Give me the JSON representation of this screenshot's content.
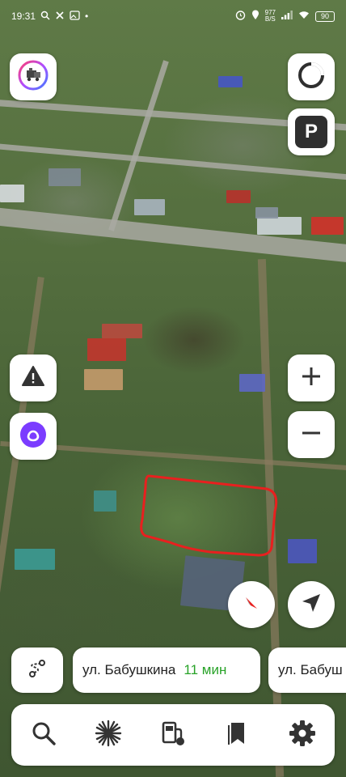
{
  "status_bar": {
    "time": "19:31",
    "net_speed": "977",
    "net_unit": "B/S",
    "battery": "90"
  },
  "route_chips": [
    {
      "street": "ул. Бабушкина",
      "eta": "11 мин"
    },
    {
      "street": "ул. Бабуш",
      "eta": ""
    }
  ],
  "colors": {
    "accent_green": "#29a329",
    "highlight_outline": "#e8201f",
    "alice_purple": "#7b3cff"
  },
  "icons": {
    "top_left": "layers-icon",
    "top_right": "circle-icon",
    "parking": "parking-icon",
    "warning": "warning-icon",
    "assistant": "alice-icon",
    "zoom_in": "plus-icon",
    "zoom_out": "minus-icon",
    "compass": "compass-icon",
    "locate": "navigation-arrow-icon",
    "route_swap": "route-icon",
    "toolbar": [
      "search-icon",
      "sun-icon",
      "fuel-icon",
      "bookmark-icon",
      "settings-icon"
    ]
  },
  "parking_label": "P"
}
